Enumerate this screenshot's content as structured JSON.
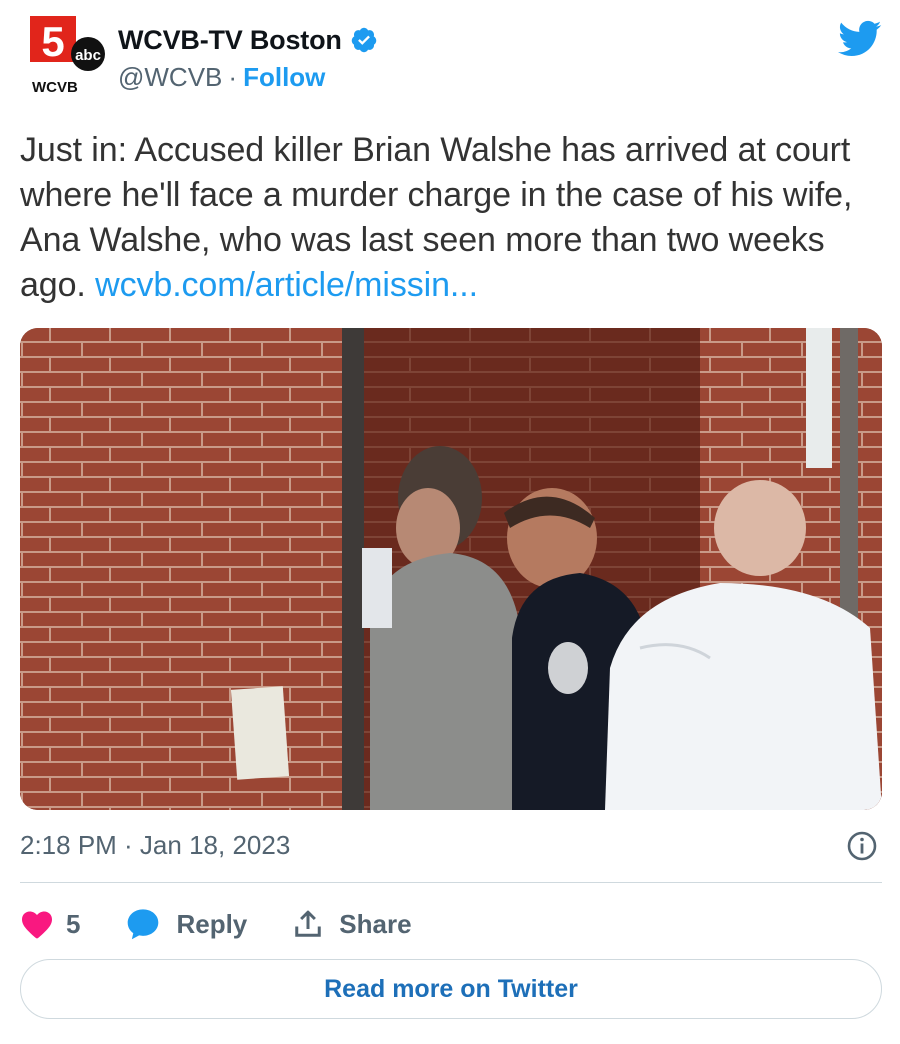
{
  "account": {
    "logo_icon": "wcvb-channel-5-logo",
    "logo_text": "WCVB",
    "logo_network": "abc",
    "display_name": "WCVB-TV Boston",
    "handle": "@WCVB",
    "separator": "·",
    "follow_label": "Follow",
    "verified_icon": "verified-badge-icon"
  },
  "tweet": {
    "text": "Just in: Accused killer Brian Walshe has arrived at court where he'll face a murder charge in the case of his wife, Ana Walshe, who was last seen more than two weeks ago. ",
    "link_text": "wcvb.com/article/missin...",
    "media_icon": "video-still-photo",
    "timestamp": "2:18 PM · Jan 18, 2023"
  },
  "actions": {
    "like_count": "5",
    "reply_label": "Reply",
    "share_label": "Share"
  },
  "footer": {
    "read_more_label": "Read more on Twitter"
  },
  "colors": {
    "link": "#1d9bf0",
    "like": "#f91880",
    "muted": "#536471",
    "text": "#333333",
    "logo_red": "#e1251b"
  }
}
